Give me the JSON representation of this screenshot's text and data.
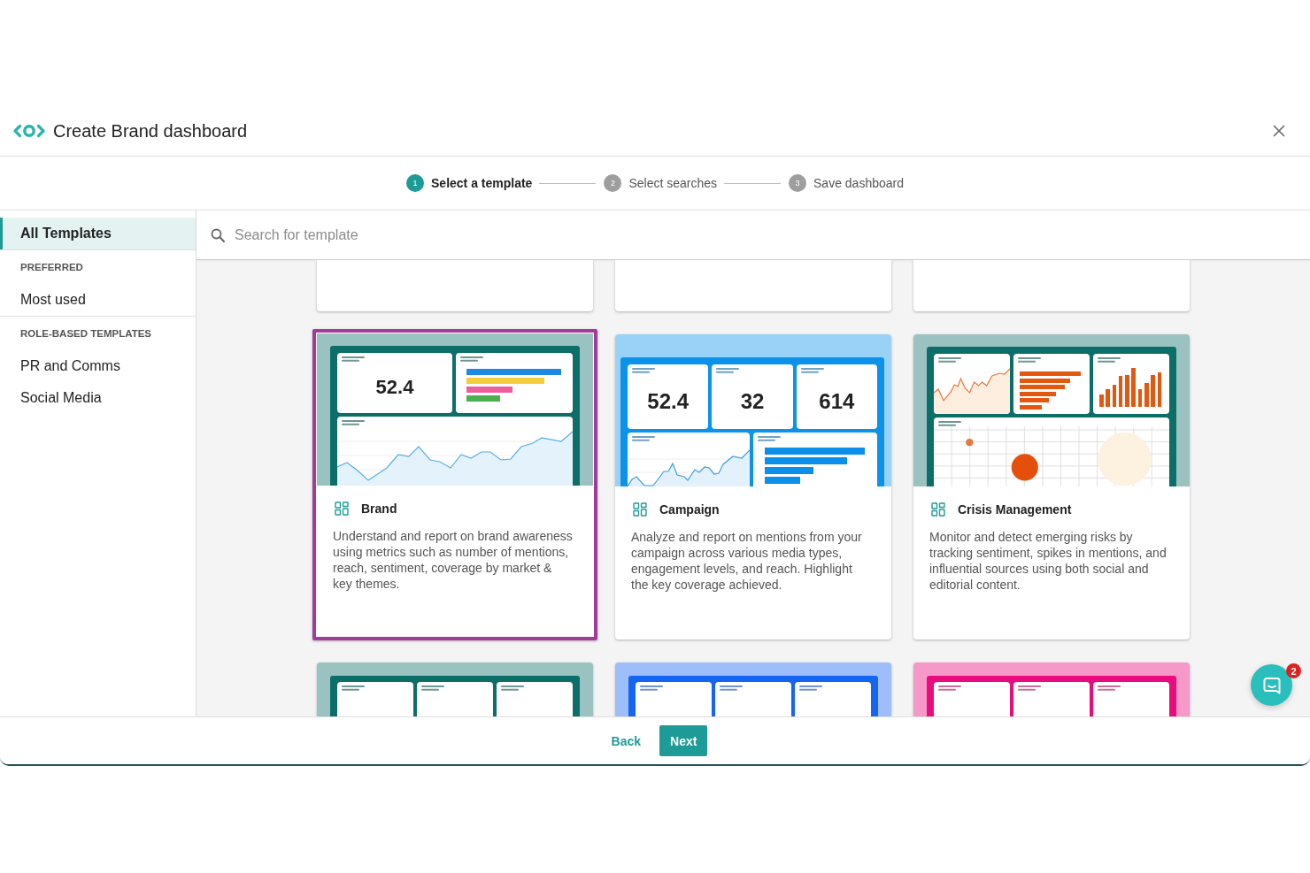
{
  "dialog": {
    "title": "Create Brand dashboard"
  },
  "stepper": {
    "steps": [
      {
        "number": "1",
        "label": "Select a template",
        "selected": true
      },
      {
        "number": "2",
        "label": "Select searches",
        "selected": false
      },
      {
        "number": "3",
        "label": "Save dashboard",
        "selected": false
      }
    ]
  },
  "sidebar": {
    "items": [
      {
        "label": "All Templates",
        "selected": true
      }
    ],
    "groups": [
      {
        "heading": "PREFERRED",
        "items": [
          {
            "label": "Most used",
            "selected": false
          }
        ]
      },
      {
        "heading": "ROLE-BASED TEMPLATES",
        "items": [
          {
            "label": "PR and Comms",
            "selected": false
          },
          {
            "label": "Social Media",
            "selected": false
          }
        ]
      }
    ]
  },
  "search": {
    "placeholder": "Search for template"
  },
  "templates": [
    {
      "kind": "bottom-edge",
      "selected": false
    },
    {
      "kind": "bottom-edge",
      "selected": false
    },
    {
      "kind": "bottom-edge",
      "selected": false
    },
    {
      "kind": "full",
      "selected": true,
      "title": "Brand",
      "description": "Understand and report on brand awareness using metrics such as number of mentions, reach, sentiment, coverage by market & key themes.",
      "preview": {
        "kind": "brand",
        "color": "#0b6e69",
        "metrics": [
          "52.4"
        ]
      }
    },
    {
      "kind": "full",
      "selected": false,
      "title": "Campaign",
      "description": "Analyze and report on mentions from your campaign across various media types, engagement levels, and reach. Highlight the key coverage achieved.",
      "preview": {
        "kind": "campaign",
        "color": "#0b93ea",
        "metrics": [
          "52.4",
          "32",
          "614"
        ]
      }
    },
    {
      "kind": "full",
      "selected": false,
      "title": "Crisis Management",
      "description": "Monitor and detect emerging risks by tracking sentiment, spikes in mentions, and influential sources using both social and editorial content.",
      "preview": {
        "kind": "crisis",
        "color": "#0b6e69"
      }
    },
    {
      "kind": "top-edge",
      "selected": false,
      "preview": {
        "kind": "metrics",
        "color": "#0b6e69"
      }
    },
    {
      "kind": "top-edge",
      "selected": false,
      "preview": {
        "kind": "metrics",
        "color": "#1565f2"
      }
    },
    {
      "kind": "top-edge",
      "selected": false,
      "preview": {
        "kind": "metrics",
        "color": "#ea0b7c"
      }
    }
  ],
  "footer": {
    "back": "Back",
    "next": "Next"
  },
  "chat_widget": {
    "badge": "2"
  }
}
